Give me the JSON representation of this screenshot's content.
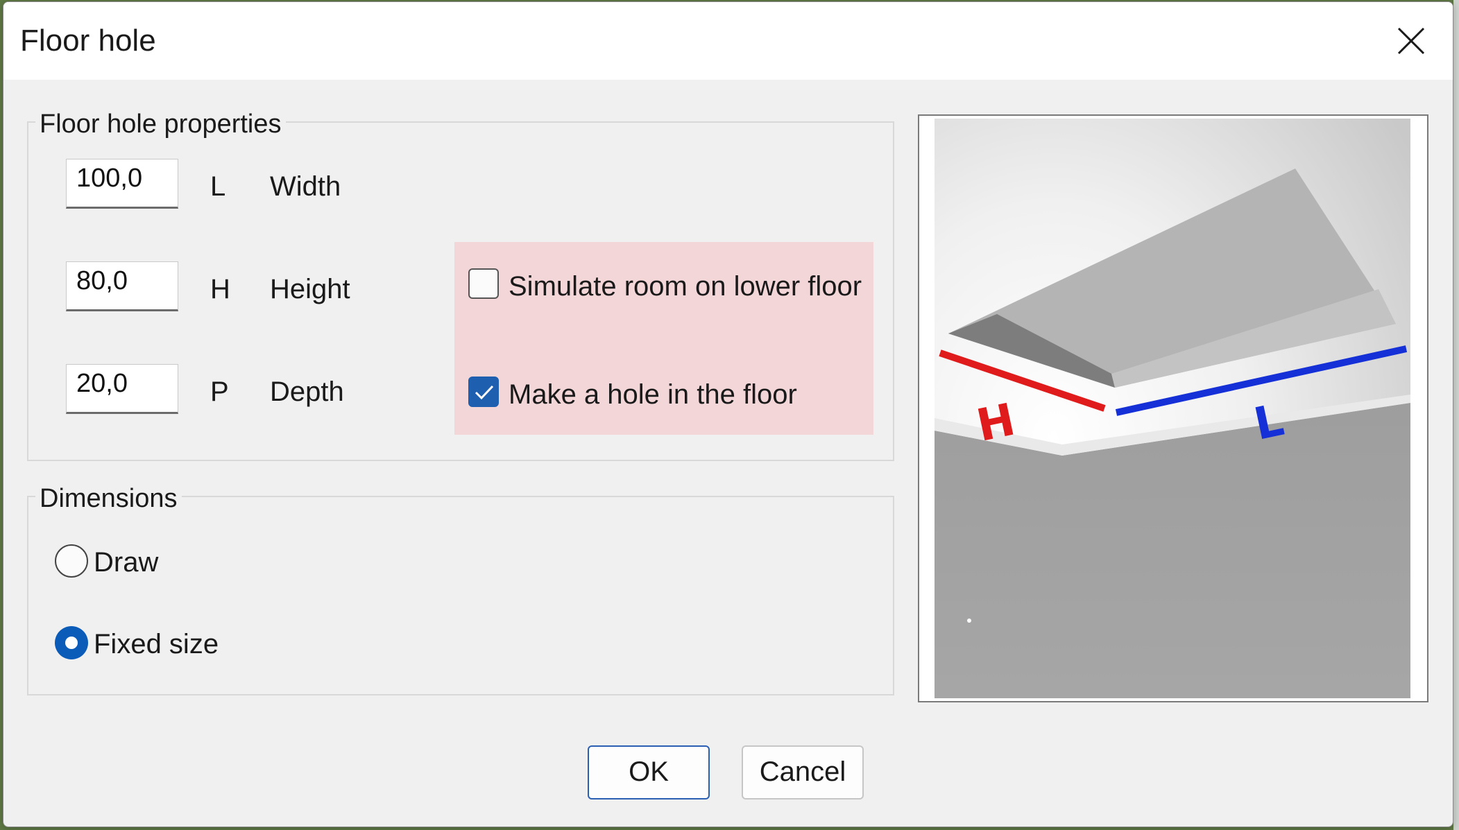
{
  "dialog": {
    "title": "Floor hole",
    "close_icon": "close-icon"
  },
  "properties": {
    "legend": "Floor hole properties",
    "fields": [
      {
        "value": "100,0",
        "symbol": "L",
        "label": "Width"
      },
      {
        "value": "80,0",
        "symbol": "H",
        "label": "Height"
      },
      {
        "value": "20,0",
        "symbol": "P",
        "label": "Depth"
      }
    ],
    "options": [
      {
        "label": "Simulate room on lower floor",
        "checked": false
      },
      {
        "label": "Make a hole in the floor",
        "checked": true
      }
    ],
    "options_highlight_color": "#f3d6d8"
  },
  "dimensions": {
    "legend": "Dimensions",
    "choices": [
      {
        "label": "Draw",
        "selected": false
      },
      {
        "label": "Fixed size",
        "selected": true
      }
    ]
  },
  "preview": {
    "label_h": "H",
    "label_l": "L",
    "h_color": "#e01b1b",
    "l_color": "#1530d6"
  },
  "buttons": {
    "ok_label": "OK",
    "cancel_label": "Cancel"
  },
  "colors": {
    "accent": "#1e5fb0",
    "dialog_bg": "#f0f0f0"
  }
}
